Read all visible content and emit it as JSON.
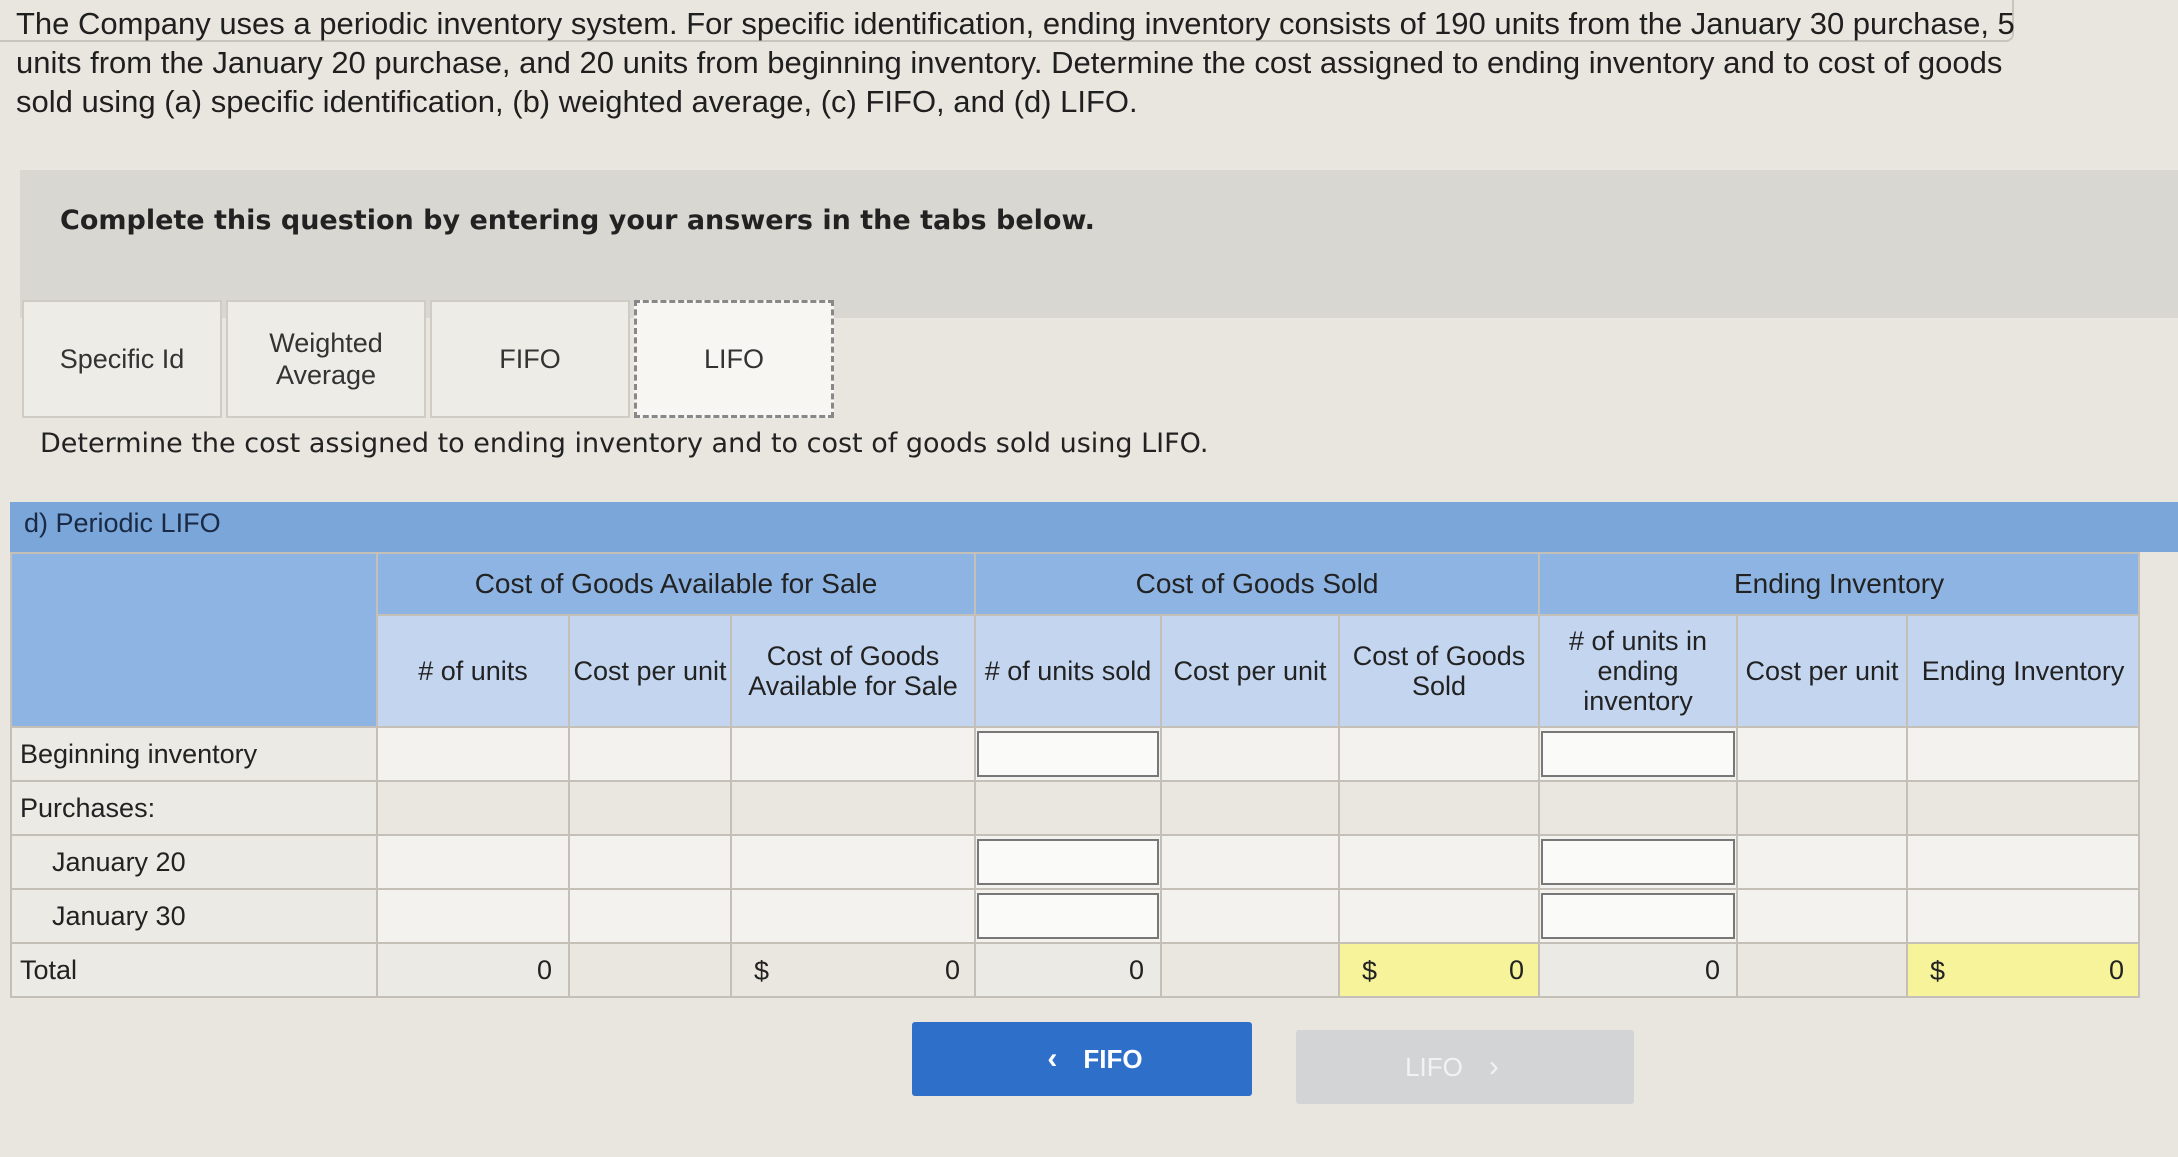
{
  "question": {
    "text": "The Company uses a periodic inventory system. For specific identification, ending inventory consists of 190 units from the January 30 purchase, 5 units from the January 20 purchase, and 20 units from beginning inventory. Determine the cost assigned to ending inventory and to cost of goods sold using (a) specific identification, (b) weighted average, (c) FIFO, and (d) LIFO."
  },
  "instruction": "Complete this question by entering your answers in the tabs below.",
  "tabs": [
    {
      "label": "Specific Id"
    },
    {
      "label": "Weighted Average"
    },
    {
      "label": "FIFO"
    },
    {
      "label": "LIFO",
      "active": true
    }
  ],
  "subinstruction": "Determine the cost assigned to ending inventory and to cost of goods sold using LIFO.",
  "section_title": "d) Periodic LIFO",
  "table": {
    "groups": {
      "available": "Cost of Goods Available for Sale",
      "sold": "Cost of Goods Sold",
      "ending": "Ending Inventory"
    },
    "columns": [
      "# of units",
      "Cost per unit",
      "Cost of Goods Available for Sale",
      "# of units sold",
      "Cost per unit",
      "Cost of Goods Sold",
      "# of units in ending inventory",
      "Cost per unit",
      "Ending Inventory"
    ],
    "rows": [
      {
        "label": "Beginning inventory"
      },
      {
        "label": "Purchases:"
      },
      {
        "label": "January 20"
      },
      {
        "label": "January 30"
      }
    ],
    "total": {
      "label": "Total",
      "units": "0",
      "currency": "$",
      "cogas": "0",
      "units_sold": "0",
      "cogs": "0",
      "units_ending": "0",
      "ending_inventory": "0"
    }
  },
  "buttons": {
    "prev": "FIFO",
    "next": "LIFO",
    "prev_icon": "chevron-left-icon",
    "next_icon": "chevron-right-icon"
  }
}
